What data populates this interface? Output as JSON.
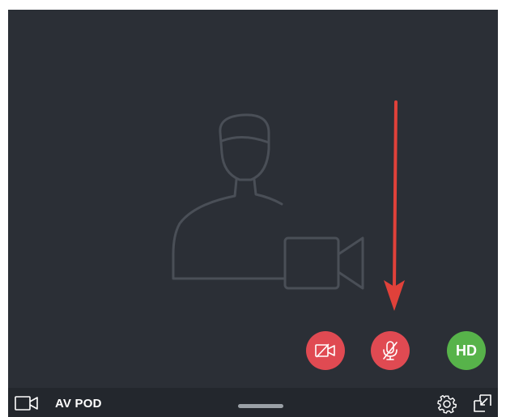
{
  "window": {
    "background_color": "#2b2f36",
    "placeholder_icon": "user-with-video-camera-icon"
  },
  "annotation": {
    "arrow_color": "#e0413a",
    "points_to": "mute-microphone-button"
  },
  "controls": {
    "video_toggle": {
      "icon": "video-off-icon",
      "color": "#e04a52"
    },
    "mic_toggle": {
      "icon": "mic-off-icon",
      "color": "#e04a52"
    },
    "hd": {
      "label": "HD",
      "color": "#57b34a"
    }
  },
  "bottom_bar": {
    "title": "AV POD",
    "camera_icon": "video-camera-icon",
    "settings_icon": "gear-icon",
    "minimize_icon": "minimize-icon"
  }
}
